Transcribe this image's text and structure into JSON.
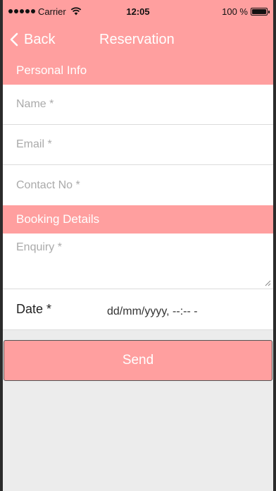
{
  "status_bar": {
    "carrier": "Carrier",
    "time": "12:05",
    "battery": "100 %"
  },
  "nav": {
    "back_label": "Back",
    "title": "Reservation"
  },
  "personal_info": {
    "header": "Personal Info",
    "name_placeholder": "Name *",
    "email_placeholder": "Email *",
    "contact_placeholder": "Contact No *"
  },
  "booking": {
    "header": "Booking Details",
    "enquiry_placeholder": "Enquiry *",
    "date_label": "Date *",
    "date_value": "dd/mm/yyyy, --:-- -"
  },
  "send_label": "Send",
  "colors": {
    "accent": "#ff9f9f",
    "background": "#ececec"
  }
}
